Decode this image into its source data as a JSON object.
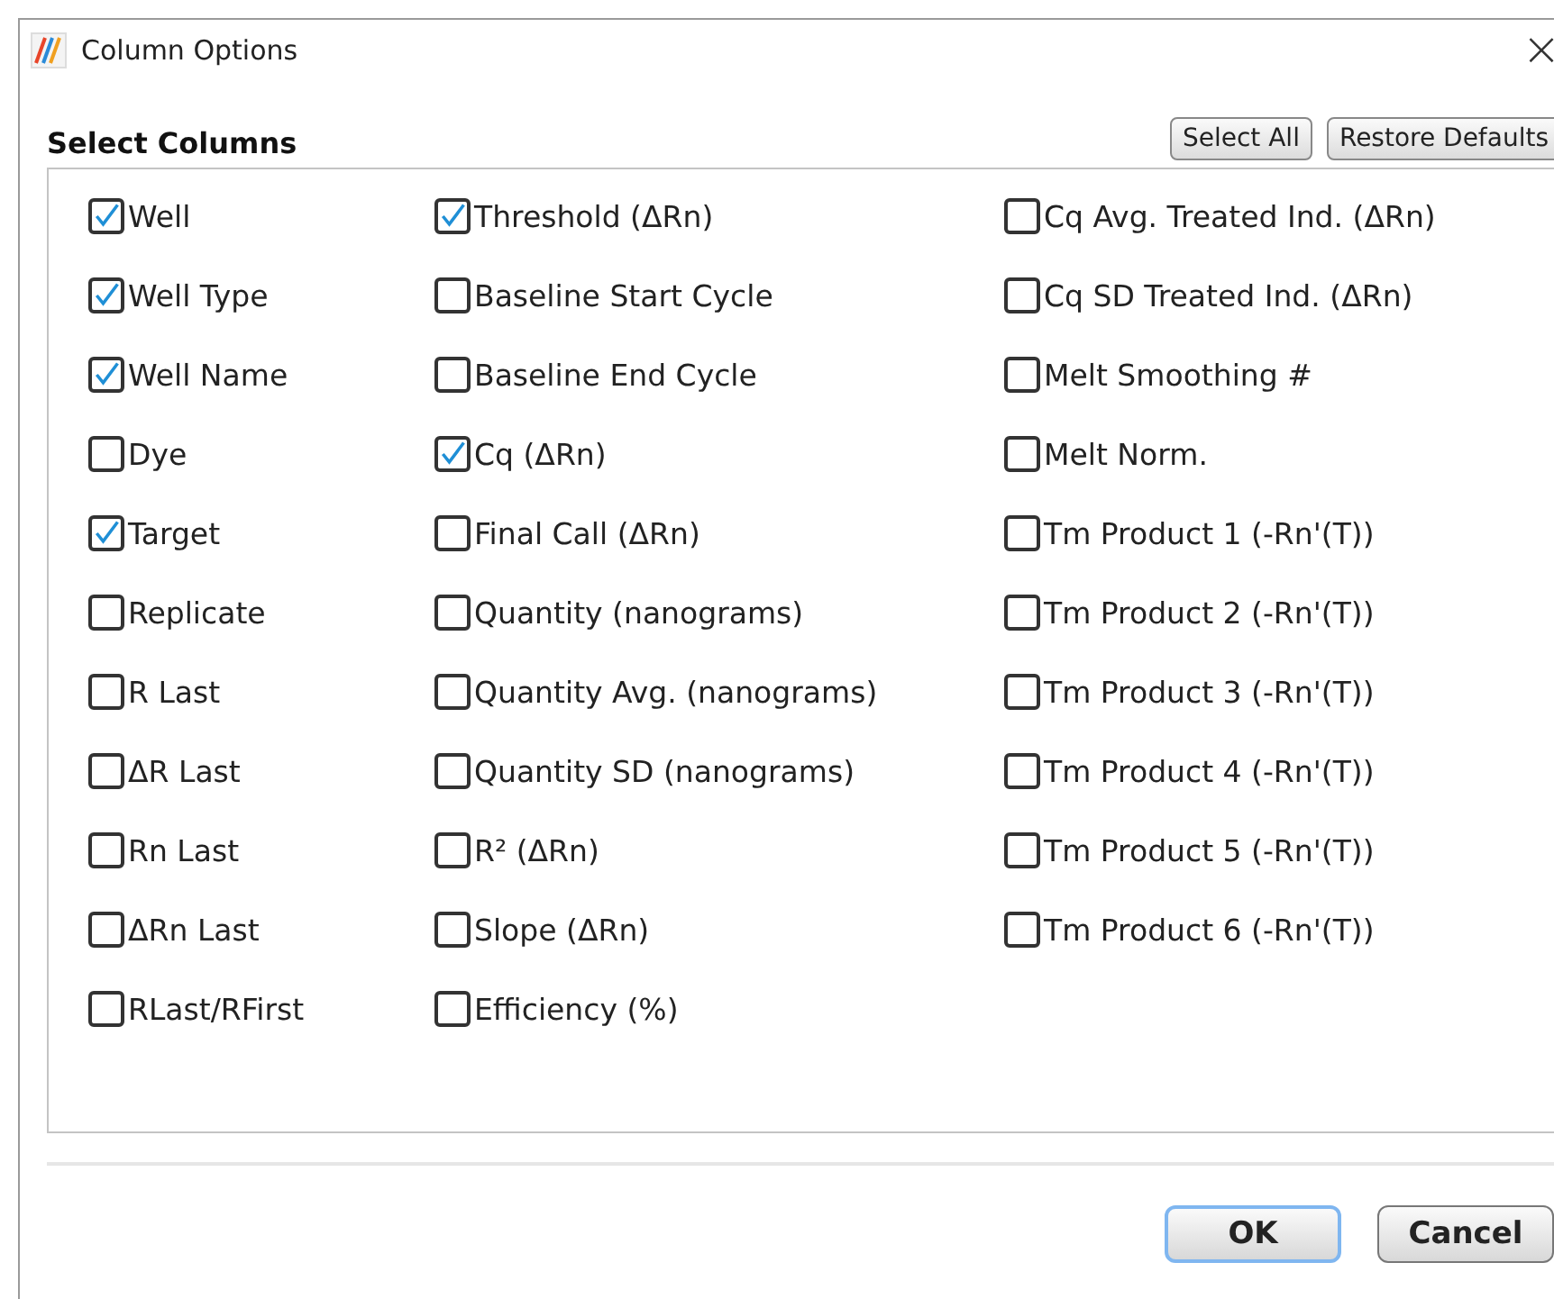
{
  "window": {
    "title": "Column Options",
    "close": "×"
  },
  "heading": "Select Columns",
  "top_buttons": [
    "Select All",
    "Restore Defaults"
  ],
  "columns": [
    [
      {
        "label": "Well",
        "checked": true
      },
      {
        "label": "Well Type",
        "checked": true
      },
      {
        "label": "Well Name",
        "checked": true
      },
      {
        "label": "Dye",
        "checked": false
      },
      {
        "label": "Target",
        "checked": true
      },
      {
        "label": "Replicate",
        "checked": false
      },
      {
        "label": "R Last",
        "checked": false
      },
      {
        "label": "ΔR Last",
        "checked": false
      },
      {
        "label": "Rn Last",
        "checked": false
      },
      {
        "label": "ΔRn Last",
        "checked": false
      },
      {
        "label": "RLast/RFirst",
        "checked": false
      }
    ],
    [
      {
        "label": "Threshold (ΔRn)",
        "checked": true
      },
      {
        "label": "Baseline Start Cycle",
        "checked": false
      },
      {
        "label": "Baseline End Cycle",
        "checked": false
      },
      {
        "label": "Cq (ΔRn)",
        "checked": true
      },
      {
        "label": "Final Call (ΔRn)",
        "checked": false
      },
      {
        "label": "Quantity (nanograms)",
        "checked": false
      },
      {
        "label": "Quantity Avg. (nanograms)",
        "checked": false
      },
      {
        "label": "Quantity SD (nanograms)",
        "checked": false
      },
      {
        "label": "R² (ΔRn)",
        "checked": false
      },
      {
        "label": "Slope (ΔRn)",
        "checked": false
      },
      {
        "label": "Efficiency (%)",
        "checked": false
      }
    ],
    [
      {
        "label": "Cq Avg. Treated Ind. (ΔRn)",
        "checked": false
      },
      {
        "label": "Cq SD Treated Ind. (ΔRn)",
        "checked": false
      },
      {
        "label": "Melt Smoothing #",
        "checked": false
      },
      {
        "label": "Melt Norm.",
        "checked": false
      },
      {
        "label": "Tm Product 1 (-Rn'(T))",
        "checked": false
      },
      {
        "label": "Tm Product 2 (-Rn'(T))",
        "checked": false
      },
      {
        "label": "Tm Product 3 (-Rn'(T))",
        "checked": false
      },
      {
        "label": "Tm Product 4 (-Rn'(T))",
        "checked": false
      },
      {
        "label": "Tm Product 5 (-Rn'(T))",
        "checked": false
      },
      {
        "label": "Tm Product 6 (-Rn'(T))",
        "checked": false
      }
    ]
  ],
  "footer_buttons": [
    {
      "label": "OK",
      "focused": true
    },
    {
      "label": "Cancel",
      "focused": false
    }
  ]
}
